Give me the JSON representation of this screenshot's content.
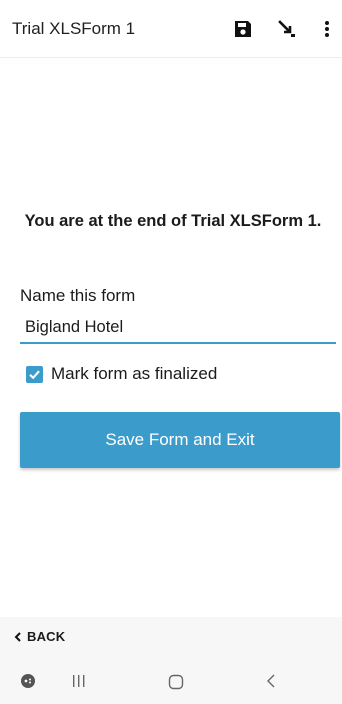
{
  "app_bar": {
    "title": "Trial XLSForm 1",
    "icons": [
      "save-icon",
      "go-to-question-icon",
      "more-options-icon"
    ]
  },
  "main": {
    "end_message": "You are at the end of Trial XLSForm 1.",
    "name_label": "Name this form",
    "name_value": "Bigland Hotel",
    "finalize_checked": true,
    "finalize_label": "Mark form as finalized",
    "save_button_label": "Save Form and Exit"
  },
  "bottom_nav": {
    "back_label": "BACK"
  },
  "system_nav": {
    "icons": [
      "game-launcher-icon",
      "recents-icon",
      "home-icon",
      "back-icon"
    ]
  },
  "colors": {
    "accent": "#3b9ccb",
    "text": "#1b1b1b",
    "background": "#ffffff",
    "bar": "#f7f7f7"
  }
}
